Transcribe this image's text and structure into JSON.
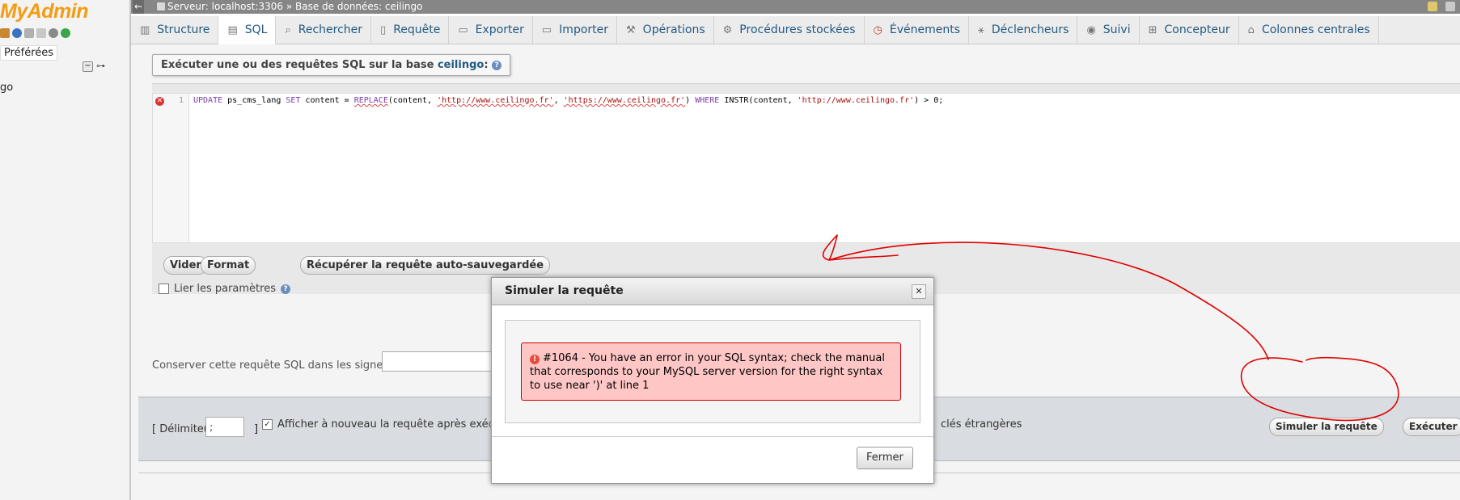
{
  "left_panel": {
    "logo": "MyAdmin",
    "preferences_label": "Préférées",
    "db_item": "go"
  },
  "topbar": {
    "back": "←",
    "breadcrumb": "Serveur: localhost:3306 » Base de données: ceilingo"
  },
  "tabs": [
    {
      "label": "Structure",
      "icon": "structure-icon"
    },
    {
      "label": "SQL",
      "icon": "sql-icon"
    },
    {
      "label": "Rechercher",
      "icon": "search-icon"
    },
    {
      "label": "Requête",
      "icon": "query-icon"
    },
    {
      "label": "Exporter",
      "icon": "export-icon"
    },
    {
      "label": "Importer",
      "icon": "import-icon"
    },
    {
      "label": "Opérations",
      "icon": "wrench-icon"
    },
    {
      "label": "Procédures stockées",
      "icon": "routines-icon"
    },
    {
      "label": "Événements",
      "icon": "clock-icon"
    },
    {
      "label": "Déclencheurs",
      "icon": "triggers-icon"
    },
    {
      "label": "Suivi",
      "icon": "eye-icon"
    },
    {
      "label": "Concepteur",
      "icon": "designer-icon"
    },
    {
      "label": "Colonnes centrales",
      "icon": "columns-icon"
    }
  ],
  "sql_panel": {
    "legend_prefix": "Exécuter une ou des requêtes SQL sur la base",
    "db_name": "ceilingo",
    "legend_suffix": ":",
    "line_number": "1",
    "query": {
      "p1": "UPDATE",
      "p2": " ps_cms_lang ",
      "p3": "SET",
      "p4": " content = ",
      "p5": "REPLACE",
      "p6": "(content, ",
      "p7": "'http://www.ceilingo.fr'",
      "p8": ", ",
      "p9": "'https://www.ceilingo.fr'",
      "p10": ") ",
      "p11": "WHERE",
      "p12": " INSTR(content, ",
      "p13": "'http://www.ceilingo.fr'",
      "p14": ") > 0;"
    },
    "buttons": {
      "clear": "Vider",
      "format": "Format",
      "recover": "Récupérer la requête auto-sauvegardée"
    },
    "bind_params_label": "Lier les paramètres",
    "bookmark_label": "Conserver cette requête SQL dans les signets :"
  },
  "bottom_bar": {
    "delimiter_label": "[ Délimiteur",
    "delimiter_value": ";",
    "delimiter_end": "]",
    "show_again_label": "Afficher à nouveau la requête après exécuti",
    "fk_label": "clés étrangères",
    "simulate": "Simuler la requête",
    "execute": "Exécuter"
  },
  "dialog": {
    "title": "Simuler la requête",
    "close": "✕",
    "error_text": "#1064 - You have an error in your SQL syntax; check the manual that corresponds to your MySQL server version for the right syntax to use near ')' at line 1",
    "close_button": "Fermer"
  },
  "colors": {
    "tab_text": "#235a81",
    "error_bg": "#ffc6c6",
    "error_border": "#cc0000",
    "annotation": "#e00000"
  }
}
